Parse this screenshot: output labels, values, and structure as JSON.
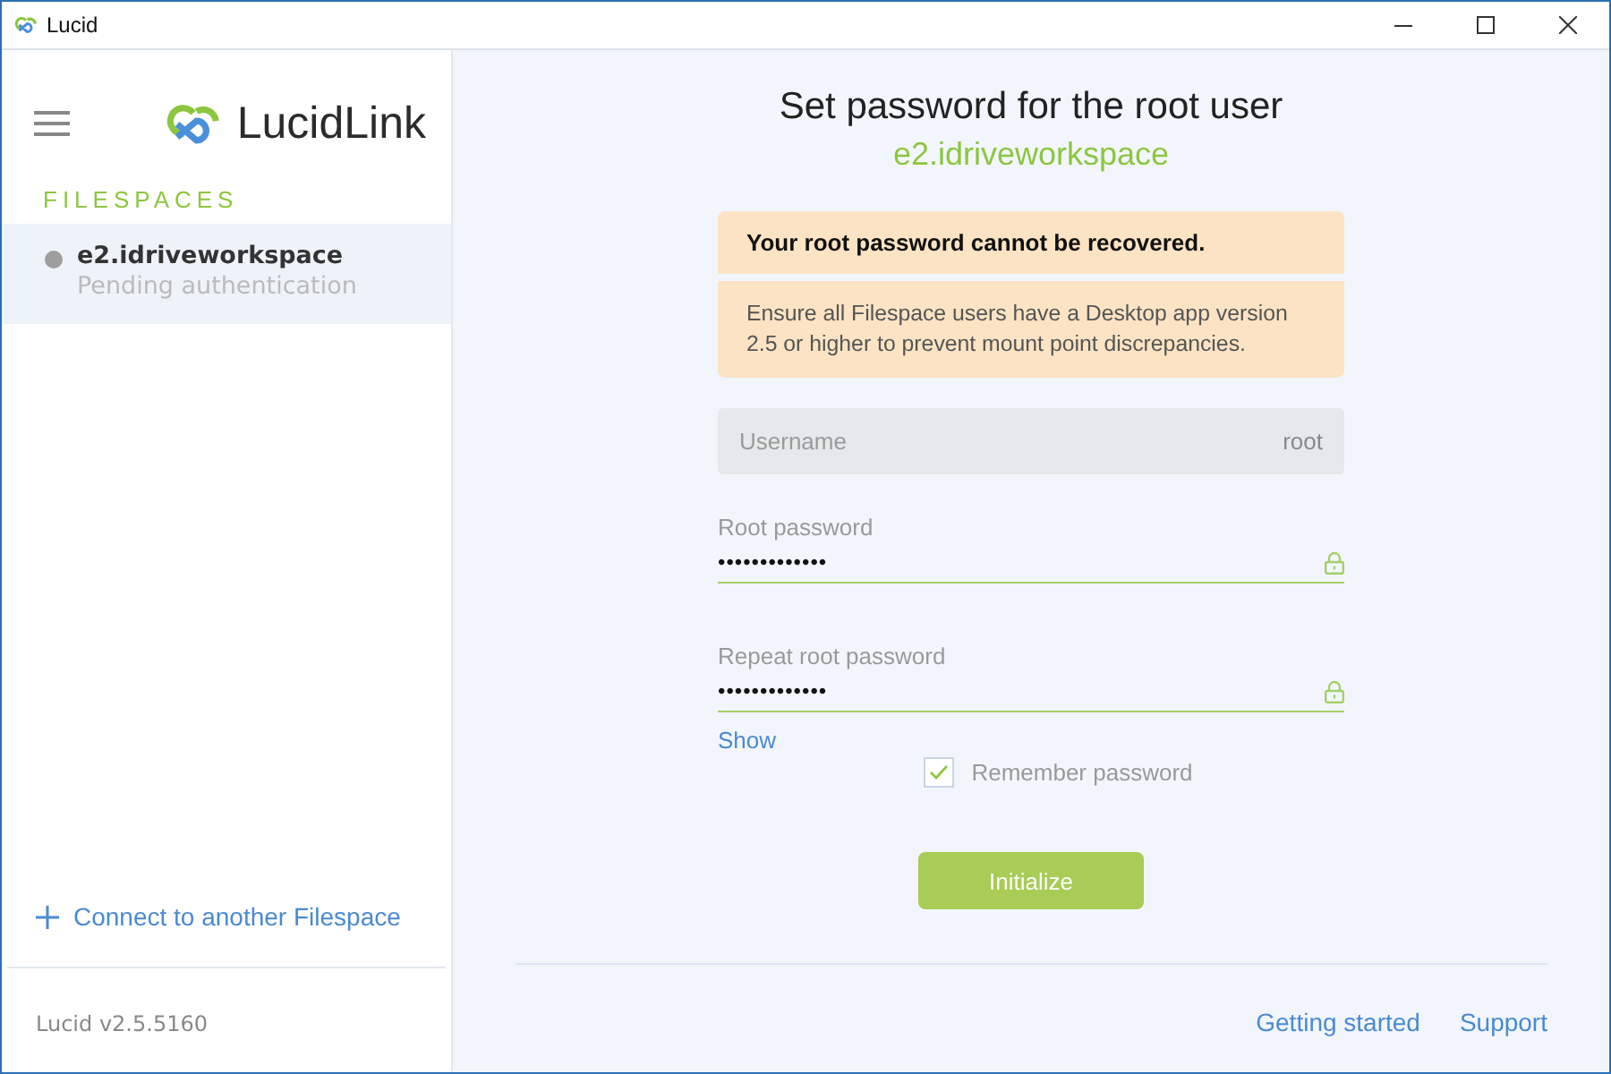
{
  "window": {
    "title": "Lucid"
  },
  "sidebar": {
    "logo_text": "LucidLink",
    "section_label": "FILESPACES",
    "filespaces": [
      {
        "name": "e2.idriveworkspace",
        "status": "Pending authentication",
        "selected": true,
        "color": "#9e9e9e"
      }
    ],
    "connect_link": "Connect to another Filespace",
    "version": "Lucid v2.5.5160"
  },
  "main": {
    "title": "Set password for the root user",
    "subtitle": "e2.idriveworkspace",
    "warning": {
      "heading": "Your root password cannot be recovered.",
      "body": "Ensure all Filespace users have a Desktop app version 2.5 or higher to prevent mount point discrepancies."
    },
    "username": {
      "placeholder": "Username",
      "value": "root",
      "disabled": true
    },
    "password_fields": [
      {
        "label": "Root password",
        "value": "•••••••••••••"
      },
      {
        "label": "Repeat root password",
        "value": "•••••••••••••"
      }
    ],
    "show_link": "Show",
    "remember": {
      "label": "Remember password",
      "checked": true
    },
    "button": "Initialize",
    "footer_links": [
      "Getting started",
      "Support"
    ]
  }
}
